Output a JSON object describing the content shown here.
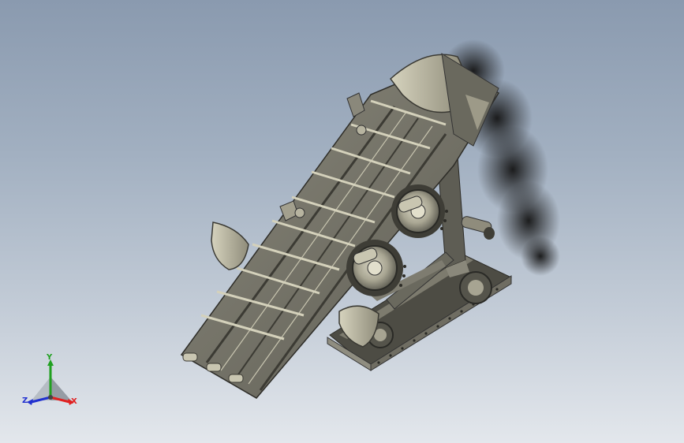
{
  "viewport": {
    "background_top": "#8a9aaf",
    "background_bottom": "#e3e7ec"
  },
  "model": {
    "part_color": "#6f6e63",
    "part_highlight": "#b6b39f",
    "part_shadow": "#3e3d36",
    "shadow_color": "#1a1a1a"
  },
  "triad": {
    "x_label": "X",
    "y_label": "Y",
    "z_label": "Z",
    "x_color": "#e02020",
    "y_color": "#20a020",
    "z_color": "#2030d0"
  }
}
